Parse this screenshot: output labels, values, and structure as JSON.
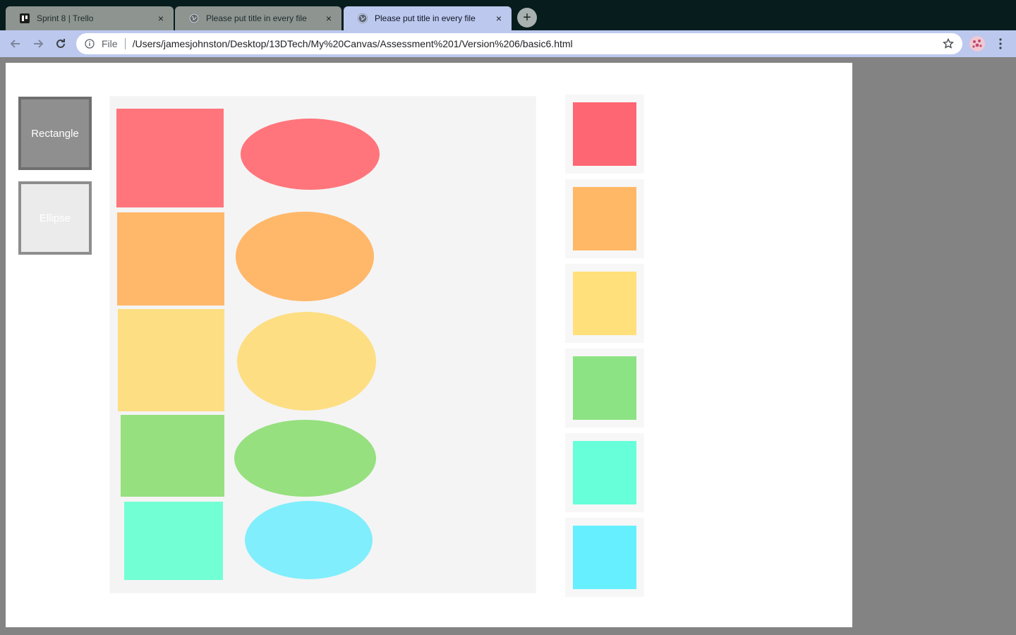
{
  "browser": {
    "tabs": [
      {
        "title": "Sprint 8 | Trello",
        "favicon": "trello-icon",
        "active": false
      },
      {
        "title": "Please put title in every file",
        "favicon": "globe-icon",
        "active": false
      },
      {
        "title": "Please put title in every file",
        "favicon": "globe-icon",
        "active": true
      }
    ],
    "new_tab_label": "+",
    "close_label": "×",
    "address": {
      "scheme": "File",
      "url": "/Users/jamesjohnston/Desktop/13DTech/My%20Canvas/Assessment%201/Version%206/basic6.html"
    }
  },
  "page": {
    "tools": [
      {
        "label": "Rectangle",
        "selected": true
      },
      {
        "label": "Ellipse",
        "selected": false
      }
    ],
    "palette": [
      "#ff6673",
      "#ffb866",
      "#ffe07a",
      "#8ce383",
      "#66ffd9",
      "#66f0ff"
    ],
    "drawn_shape_colors": {
      "rectangles": [
        "#ff757b",
        "#ffb86a",
        "#fdde82",
        "#96e07f",
        "#72ffd4"
      ],
      "ellipses": [
        "#ff757b",
        "#ffb86a",
        "#fdde82",
        "#96e07f",
        "#80eefc"
      ]
    }
  }
}
